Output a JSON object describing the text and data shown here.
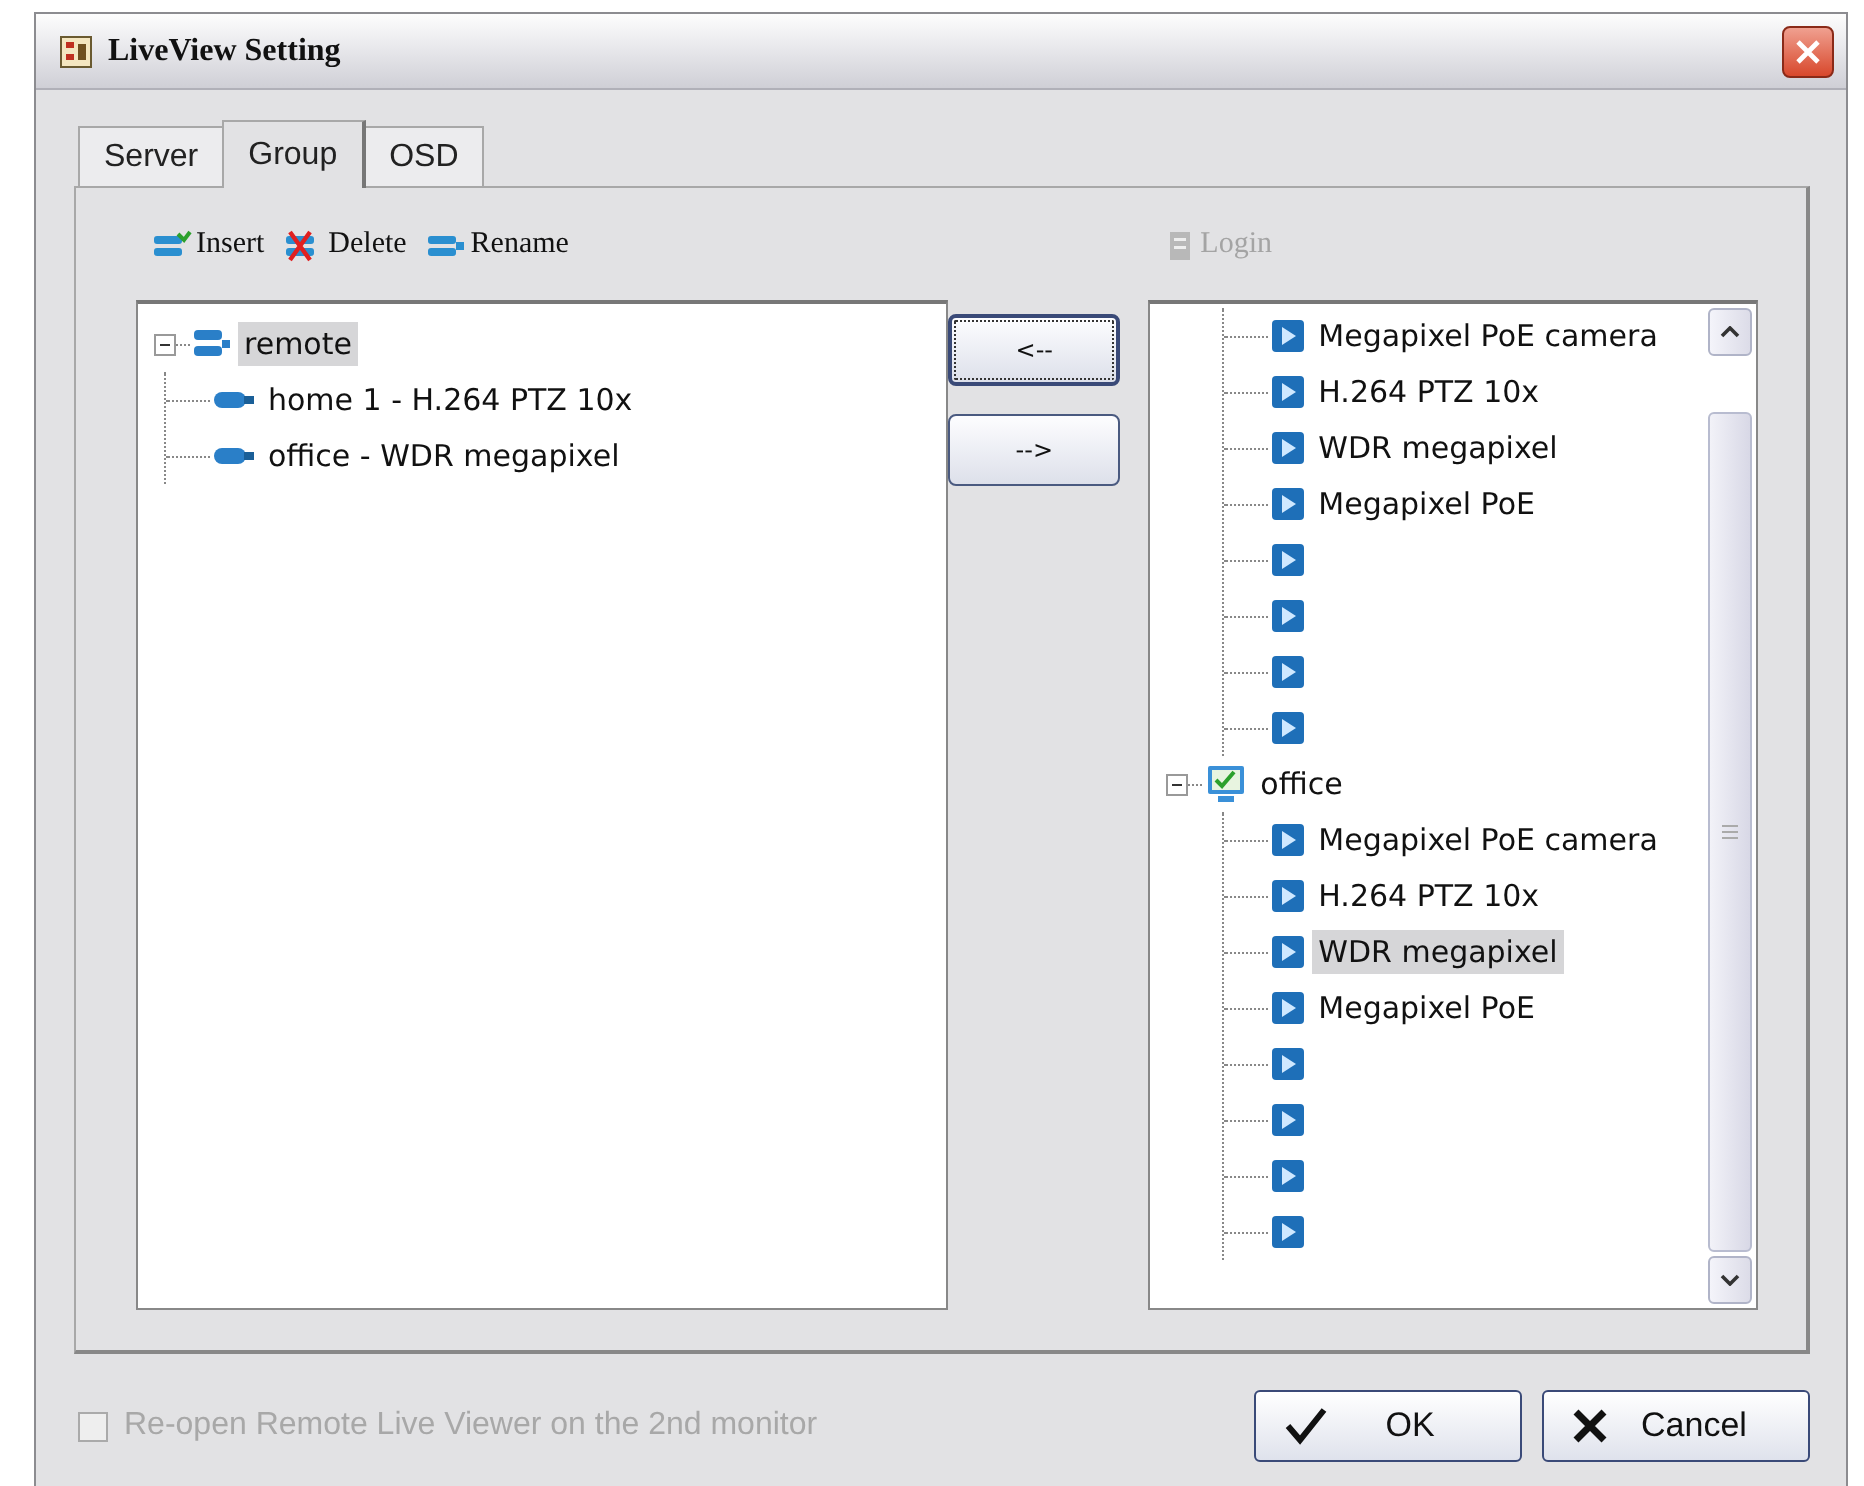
{
  "window": {
    "title": "LiveView Setting"
  },
  "tabs": [
    {
      "label": "Server",
      "selected": false
    },
    {
      "label": "Group",
      "selected": true
    },
    {
      "label": "OSD",
      "selected": false
    }
  ],
  "toolbar": [
    {
      "kind": "insert",
      "label": "Insert",
      "disabled": false
    },
    {
      "kind": "delete",
      "label": "Delete",
      "disabled": false
    },
    {
      "kind": "rename",
      "label": "Rename",
      "disabled": false
    }
  ],
  "login": {
    "label": "Login",
    "disabled": true
  },
  "left_tree": [
    {
      "label": "remote",
      "selected": true,
      "expanded": true,
      "children": [
        {
          "label": "home 1 - H.264 PTZ 10x",
          "selected": false
        },
        {
          "label": "office - WDR megapixel",
          "selected": false
        }
      ]
    }
  ],
  "move_buttons": [
    {
      "label": "<--",
      "focused": true
    },
    {
      "label": "-->",
      "focused": false
    }
  ],
  "right_tree": [
    {
      "expanded": true,
      "children": [
        {
          "label": "Megapixel PoE camera",
          "selected": false
        },
        {
          "label": "H.264 PTZ 10x",
          "selected": false
        },
        {
          "label": "WDR megapixel",
          "selected": false
        },
        {
          "label": "Megapixel PoE",
          "selected": false
        },
        {
          "kind": "channel"
        },
        {
          "kind": "channel"
        },
        {
          "kind": "channel"
        },
        {
          "kind": "channel"
        }
      ]
    },
    {
      "label": "office",
      "selected": false,
      "expanded": true,
      "children": [
        {
          "label": "Megapixel PoE camera",
          "selected": false
        },
        {
          "label": "H.264 PTZ 10x",
          "selected": false
        },
        {
          "label": "WDR megapixel",
          "selected": true
        },
        {
          "label": "Megapixel PoE",
          "selected": false
        },
        {
          "kind": "channel"
        },
        {
          "kind": "channel"
        },
        {
          "kind": "channel"
        },
        {
          "kind": "channel"
        }
      ]
    }
  ],
  "reopen_option": {
    "label": "Re-open Remote Live Viewer on the 2nd monitor",
    "checked": false,
    "disabled": true
  },
  "buttons": [
    {
      "kind": "ok",
      "label": "OK"
    },
    {
      "kind": "cancel",
      "label": "Cancel"
    }
  ]
}
